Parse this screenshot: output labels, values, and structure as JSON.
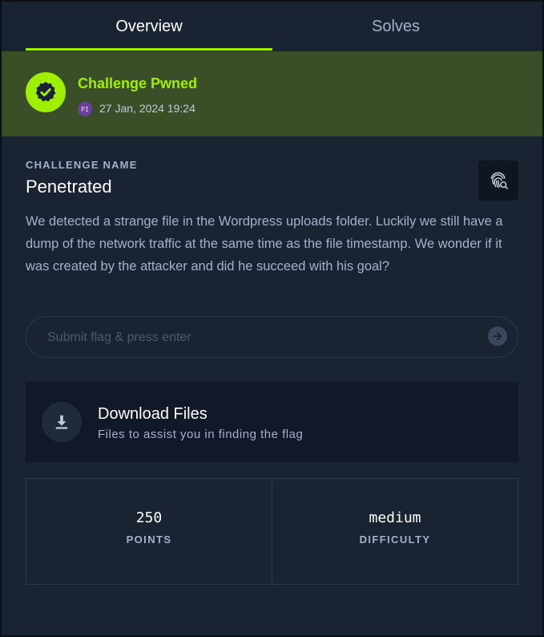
{
  "tabs": {
    "overview": "Overview",
    "solves": "Solves"
  },
  "status": {
    "title": "Challenge Pwned",
    "avatar_initials": "PI",
    "date": "27 Jan, 2024 19:24"
  },
  "challenge": {
    "section_label": "CHALLENGE NAME",
    "name": "Penetrated",
    "description": "We detected a strange file in the Wordpress uploads folder. Luckily we still have a dump of the network traffic at the same time as the file timestamp. We wonder if it was created by the attacker and did he succeed with his goal?"
  },
  "flag": {
    "placeholder": "Submit flag & press enter",
    "value": ""
  },
  "download": {
    "title": "Download Files",
    "subtitle": "Files to assist you in finding the flag"
  },
  "stats": {
    "points_value": "250",
    "points_label": "POINTS",
    "difficulty_value": "medium",
    "difficulty_label": "DIFFICULTY"
  },
  "colors": {
    "accent": "#9fef00",
    "background": "#1a2332",
    "pwned_banner": "#3a4f27",
    "muted_text": "#a4b1cd"
  },
  "icons": {
    "pwned": "verified-badge-icon",
    "fingerprint": "fingerprint-search-icon",
    "submit": "arrow-right-circle-icon",
    "download": "download-icon"
  }
}
